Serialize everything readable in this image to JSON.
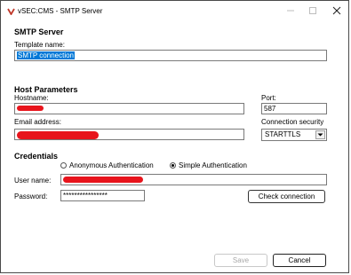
{
  "window": {
    "title": "vSEC:CMS - SMTP Server",
    "accent": "#c0392b"
  },
  "smtp": {
    "heading": "SMTP Server",
    "template_label": "Template name:",
    "template_value": "SMTP connection"
  },
  "host": {
    "heading": "Host Parameters",
    "hostname_label": "Hostname:",
    "port_label": "Port:",
    "port_value": "587",
    "email_label": "Email address:",
    "security_label": "Connection security",
    "security_value": "STARTTLS"
  },
  "credentials": {
    "heading": "Credentials",
    "auth_anonymous": "Anonymous Authentication",
    "auth_simple": "Simple Authentication",
    "auth_selected": "simple",
    "username_label": "User name:",
    "password_label": "Password:",
    "password_value": "****************",
    "check_button": "Check connection"
  },
  "footer": {
    "save_label": "Save",
    "cancel_label": "Cancel"
  },
  "colors": {
    "redaction": "#e8141c",
    "selection": "#0078d7"
  }
}
